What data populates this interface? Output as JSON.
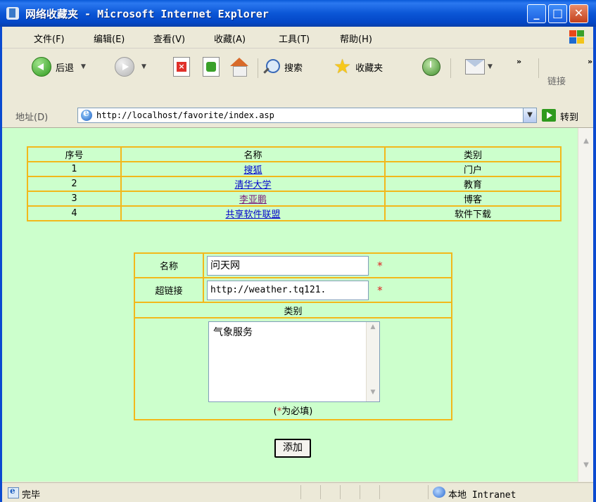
{
  "window": {
    "title": "网络收藏夹 - Microsoft Internet Explorer",
    "controls": {
      "minimize": "_",
      "maximize": "□",
      "close": "✕"
    }
  },
  "menu": [
    "文件(F)",
    "编辑(E)",
    "查看(V)",
    "收藏(A)",
    "工具(T)",
    "帮助(H)"
  ],
  "toolbar": {
    "back": "后退",
    "search": "搜索",
    "favorites": "收藏夹",
    "more": "»",
    "links": "链接"
  },
  "address": {
    "label": "地址(D)",
    "url": "http://localhost/favorite/index.asp",
    "go": "转到"
  },
  "favorites_table": {
    "headers": [
      "序号",
      "名称",
      "类别"
    ],
    "rows": [
      {
        "no": "1",
        "name": "搜狐",
        "category": "门户"
      },
      {
        "no": "2",
        "name": "清华大学",
        "category": "教育"
      },
      {
        "no": "3",
        "name": "李亚鹏",
        "category": "博客"
      },
      {
        "no": "4",
        "name": "共享软件联盟",
        "category": "软件下载"
      }
    ]
  },
  "form": {
    "name_label": "名称",
    "name_value": "问天网",
    "url_label": "超链接",
    "url_value": "http://weather.tq121.",
    "category_label": "类别",
    "category_value": "气象服务",
    "required_mark": "*",
    "note_open": "(",
    "note_star": "*",
    "note_text": "为必填)",
    "submit": "添加"
  },
  "status": {
    "text": "完毕",
    "zone": "本地 Intranet"
  }
}
